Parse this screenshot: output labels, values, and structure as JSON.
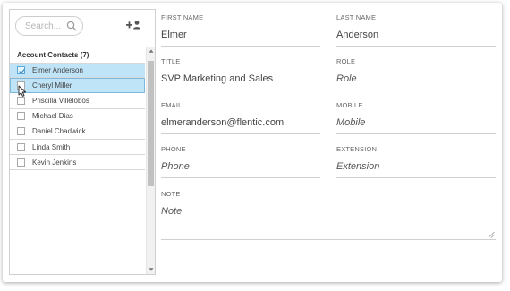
{
  "sidebar": {
    "search": {
      "placeholder": "Search..."
    },
    "list_header": "Account Contacts (7)",
    "contacts": [
      {
        "name": "Elmer Anderson",
        "checked": true,
        "selected": true
      },
      {
        "name": "Cheryl Miller",
        "checked": false,
        "selected": true
      },
      {
        "name": "Priscilla Villelobos",
        "checked": false,
        "selected": false
      },
      {
        "name": "Michael Dias",
        "checked": false,
        "selected": false
      },
      {
        "name": "Daniel Chadwick",
        "checked": false,
        "selected": false
      },
      {
        "name": "Linda Smith",
        "checked": false,
        "selected": false
      },
      {
        "name": "Kevin Jenkins",
        "checked": false,
        "selected": false
      }
    ]
  },
  "form": {
    "first_name": {
      "label": "FIRST NAME",
      "value": "Elmer"
    },
    "last_name": {
      "label": "LAST NAME",
      "value": "Anderson"
    },
    "title": {
      "label": "TITLE",
      "value": "SVP Marketing and Sales"
    },
    "role": {
      "label": "ROLE",
      "placeholder": "Role"
    },
    "email": {
      "label": "EMAIL",
      "value": "elmeranderson@flentic.com"
    },
    "mobile": {
      "label": "MOBILE",
      "placeholder": "Mobile"
    },
    "phone": {
      "label": "PHONE",
      "placeholder": "Phone"
    },
    "extension": {
      "label": "EXTENSION",
      "placeholder": "Extension"
    },
    "note": {
      "label": "NOTE",
      "placeholder": "Note"
    }
  },
  "colors": {
    "selected_row": "#bfe3f7",
    "check_accent": "#5aa6d6",
    "border": "#cfcfcf"
  },
  "icons": {
    "search": "search-icon",
    "add_contact": "add-contact-icon",
    "cursor": "mouse-pointer-icon",
    "resize": "resize-grip-icon"
  }
}
